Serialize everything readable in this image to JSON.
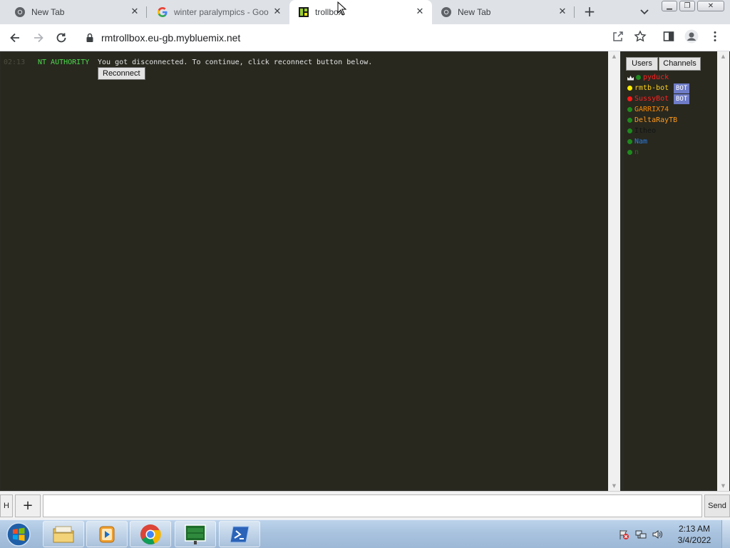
{
  "browser": {
    "tabs": [
      {
        "title": "New Tab",
        "icon": "chrome-icon",
        "active": false
      },
      {
        "title": "winter paralympics - Goo",
        "icon": "google-icon",
        "active": false
      },
      {
        "title": "trollbox",
        "icon": "trollbox-icon",
        "active": true
      },
      {
        "title": "New Tab",
        "icon": "chrome-icon",
        "active": false
      }
    ],
    "new_tab_label": "+",
    "url": "rmtrollbox.eu-gb.mybluemix.net"
  },
  "chat": {
    "messages": [
      {
        "time": "02:13",
        "nick": "NT AUTHORITY",
        "text": "You got disconnected. To continue, click reconnect button below."
      }
    ],
    "reconnect_label": "Reconnect"
  },
  "sidebar": {
    "tabs": [
      "Users",
      "Channels"
    ],
    "users": [
      {
        "name": "pyduck",
        "status_color": "#1e8a1e",
        "name_color": "#ff2020",
        "crown": true,
        "badge": ""
      },
      {
        "name": "rmtb-bot",
        "status_color": "#ffee00",
        "name_color": "#ffd21e",
        "crown": false,
        "badge": "BOT"
      },
      {
        "name": "SussyBot",
        "status_color": "#ff1a1a",
        "name_color": "#ff2020",
        "crown": false,
        "badge": "BOT"
      },
      {
        "name": "GARRIX74",
        "status_color": "#1e8a1e",
        "name_color": "#ff8c00",
        "crown": false,
        "badge": ""
      },
      {
        "name": "DeltaRayTB",
        "status_color": "#1e8a1e",
        "name_color": "#ff9a1e",
        "crown": false,
        "badge": ""
      },
      {
        "name": "Itheo",
        "status_color": "#1e8a1e",
        "name_color": "#141414",
        "crown": false,
        "badge": ""
      },
      {
        "name": "Nam",
        "status_color": "#1e8a1e",
        "name_color": "#2a7de1",
        "crown": false,
        "badge": ""
      },
      {
        "name": "n",
        "status_color": "#1e8a1e",
        "name_color": "#1e6e1e",
        "crown": false,
        "badge": ""
      }
    ]
  },
  "input": {
    "h_label": "H",
    "plus_label": "+",
    "value": "",
    "send_label": "Send"
  },
  "taskbar": {
    "apps": [
      "file-explorer",
      "media-player",
      "chrome",
      "simcity",
      "powershell"
    ],
    "time": "2:13 AM",
    "date": "3/4/2022"
  }
}
